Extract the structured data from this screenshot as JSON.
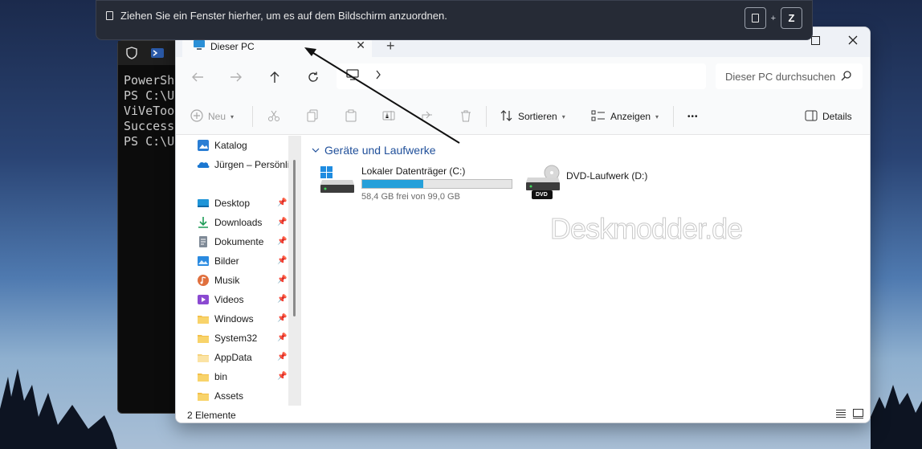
{
  "snap_hint": {
    "text": "Ziehen Sie ein Fenster hierher, um es auf dem Bildschirm anzuordnen.",
    "key_plus": "+",
    "key_letter": "Z"
  },
  "terminal": {
    "lines": [
      "PowerSh",
      "PS C:\\U",
      "ViVeToo",
      "",
      "Success",
      "PS C:\\U"
    ]
  },
  "explorer": {
    "tab_title": "Dieser PC",
    "search_placeholder": "Dieser PC durchsuchen",
    "toolbar": {
      "new_label": "Neu",
      "sort_label": "Sortieren",
      "view_label": "Anzeigen",
      "more_label": "•••",
      "details_label": "Details"
    },
    "sidebar": {
      "items": [
        {
          "label": "Katalog",
          "icon": "gallery-icon",
          "pinned": false
        },
        {
          "label": "Jürgen – Persönlic",
          "icon": "onedrive-icon",
          "pinned": false
        },
        {
          "label": "Desktop",
          "icon": "desktop-icon",
          "pinned": true
        },
        {
          "label": "Downloads",
          "icon": "download-icon",
          "pinned": true
        },
        {
          "label": "Dokumente",
          "icon": "documents-icon",
          "pinned": true
        },
        {
          "label": "Bilder",
          "icon": "pictures-icon",
          "pinned": true
        },
        {
          "label": "Musik",
          "icon": "music-icon",
          "pinned": true
        },
        {
          "label": "Videos",
          "icon": "videos-icon",
          "pinned": true
        },
        {
          "label": "Windows",
          "icon": "folder-icon",
          "pinned": true
        },
        {
          "label": "System32",
          "icon": "folder-icon",
          "pinned": true
        },
        {
          "label": "AppData",
          "icon": "folder-icon",
          "pinned": true
        },
        {
          "label": "bin",
          "icon": "folder-icon",
          "pinned": true
        },
        {
          "label": "Assets",
          "icon": "folder-icon",
          "pinned": false
        }
      ]
    },
    "group_header": "Geräte und Laufwerke",
    "drives": {
      "c_name": "Lokaler Datenträger (C:)",
      "c_free": "58,4 GB frei von 99,0 GB",
      "c_used_fraction": 0.41,
      "d_name": "DVD-Laufwerk (D:)",
      "d_badge": "DVD"
    },
    "watermark": "Deskmodder.de",
    "status": "2 Elemente"
  },
  "colors": {
    "accent": "#26a0da",
    "group_header": "#1f4f9a",
    "snapbar_bg": "#262b36"
  }
}
